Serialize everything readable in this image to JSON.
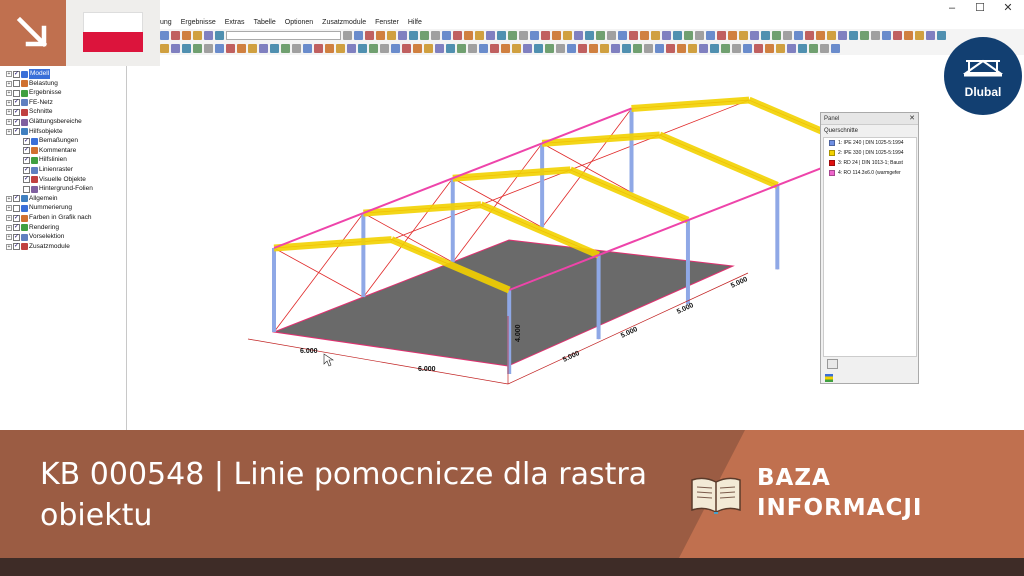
{
  "window": {
    "controls": {
      "minimize": "–",
      "maximize": "☐",
      "close": "✕"
    }
  },
  "menu": [
    "ung",
    "Ergebnisse",
    "Extras",
    "Tabelle",
    "Optionen",
    "Zusatzmodule",
    "Fenster",
    "Hilfe"
  ],
  "toolbar": {
    "combo_value": ""
  },
  "navigator": {
    "items": [
      {
        "label": "Modell",
        "checked": true,
        "selected": true,
        "level": 0
      },
      {
        "label": "Belastung",
        "checked": false,
        "level": 0
      },
      {
        "label": "Ergebnisse",
        "checked": false,
        "level": 0
      },
      {
        "label": "FE-Netz",
        "checked": true,
        "level": 0
      },
      {
        "label": "Schnitte",
        "checked": true,
        "level": 0
      },
      {
        "label": "Glättungsbereiche",
        "checked": true,
        "level": 0
      },
      {
        "label": "Hilfsobjekte",
        "checked": true,
        "level": 0
      },
      {
        "label": "Bemaßungen",
        "checked": true,
        "level": 1
      },
      {
        "label": "Kommentare",
        "checked": true,
        "level": 1
      },
      {
        "label": "Hilfslinien",
        "checked": true,
        "level": 1
      },
      {
        "label": "Linienraster",
        "checked": true,
        "level": 1
      },
      {
        "label": "Visuelle Objekte",
        "checked": true,
        "level": 1
      },
      {
        "label": "Hintergrund-Folien",
        "checked": false,
        "level": 1
      },
      {
        "label": "Allgemein",
        "checked": true,
        "level": 0
      },
      {
        "label": "Nummerierung",
        "checked": false,
        "level": 0
      },
      {
        "label": "Farben in Grafik nach",
        "checked": true,
        "level": 0
      },
      {
        "label": "Rendering",
        "checked": true,
        "level": 0
      },
      {
        "label": "Vorselektion",
        "checked": true,
        "level": 0
      },
      {
        "label": "Zusatzmodule",
        "checked": true,
        "level": 0
      }
    ]
  },
  "flag": {
    "country": "Polish flag"
  },
  "logo": {
    "text": "Dlubal"
  },
  "panel": {
    "title": "Panel",
    "close": "✕",
    "subtitle": "Querschnitte",
    "sections": [
      {
        "label": "1: IPE 240 | DIN 1025-5:1994",
        "color": "#6f8fe3"
      },
      {
        "label": "2: IPE 330 | DIN 1025-5:1994",
        "color": "#f2d200"
      },
      {
        "label": "3: RD 24 | DIN 1013-1; Baust",
        "color": "#e01010"
      },
      {
        "label": "4: RO 114.3x6.0 (warmgefer",
        "color": "#ee66cc"
      }
    ]
  },
  "dimensions": {
    "front_a": "6.000",
    "front_b": "6.000",
    "side_a": "5.000",
    "side_b": "5.000",
    "side_c": "5.000",
    "side_d": "5.000",
    "height": "4.000"
  },
  "banner": {
    "title": "KB 000548 | Linie pomocnicze dla rastra obiektu",
    "category_line1": "BAZA",
    "category_line2": "INFORMACJI"
  },
  "colors": {
    "banner_dark": "#9b5c43",
    "banner_light": "#c0704f",
    "footer": "#3e2c27",
    "accent_brand": "#123f71"
  }
}
